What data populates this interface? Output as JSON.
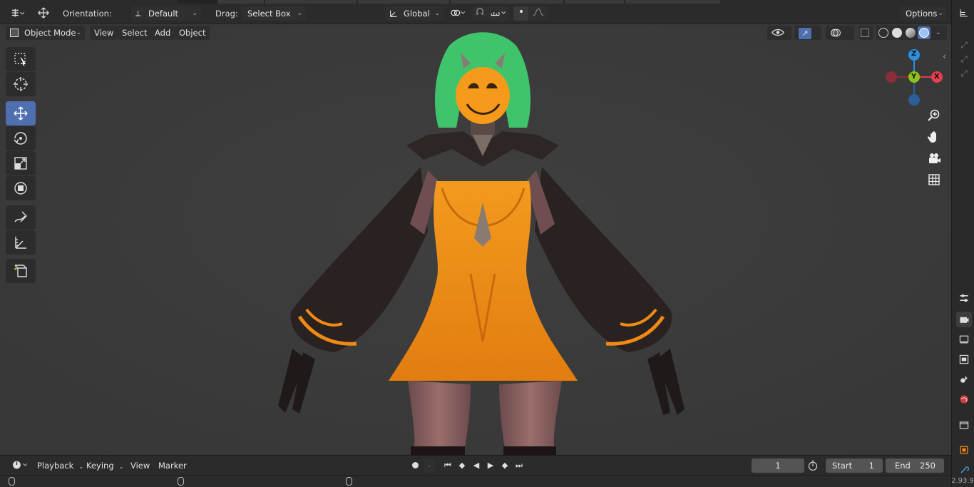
{
  "header": {
    "orientation_label": "Orientation:",
    "orientation_value": "Default",
    "drag_label": "Drag:",
    "drag_value": "Select Box",
    "transform_value": "Global",
    "options_label": "Options"
  },
  "viewport_header": {
    "mode": "Object Mode",
    "menu": [
      "View",
      "Select",
      "Add",
      "Object"
    ]
  },
  "toolbar": {
    "tools": [
      "select-box-icon",
      "cursor-icon",
      "move-icon",
      "rotate-icon",
      "scale-icon",
      "transform-icon",
      "annotate-icon",
      "measure-icon",
      "add-cube-icon"
    ],
    "active": "move-icon"
  },
  "gizmo": {
    "x": "X",
    "y": "Y",
    "z": "Z",
    "colors": {
      "x": "#e0404f",
      "y": "#8cc21a",
      "z": "#2c8fdf"
    }
  },
  "nav_icons": [
    "zoom-icon",
    "hand-pan-icon",
    "camera-icon",
    "grid-ortho-icon"
  ],
  "timeline": {
    "menu": [
      "Playback",
      "Keying",
      "View",
      "Marker"
    ],
    "current_frame": "1",
    "start_label": "Start",
    "start_value": "1",
    "end_label": "End",
    "end_value": "250"
  },
  "status": {
    "version": "2.93.9"
  },
  "colors": {
    "accent": "#4f6fb0",
    "viewport_bg": "#3d3d3d",
    "dress": "#f08a14",
    "hair": "#3fc46b"
  }
}
